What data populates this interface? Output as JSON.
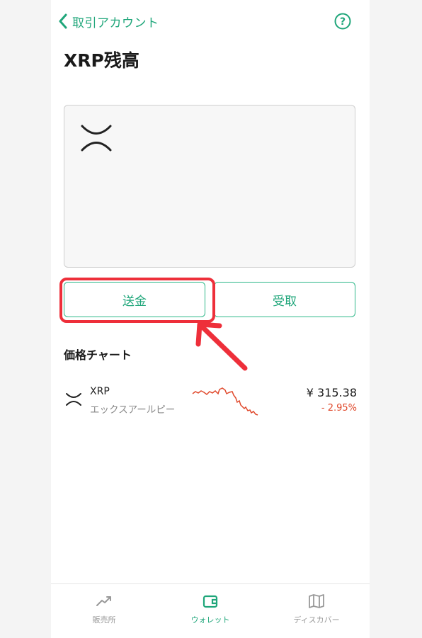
{
  "header": {
    "back_label": "取引アカウント"
  },
  "page": {
    "title": "XRP残高"
  },
  "actions": {
    "send_label": "送金",
    "receive_label": "受取"
  },
  "price_chart": {
    "section_title": "価格チャート",
    "coin_symbol": "XRP",
    "coin_name": "エックスアールピー",
    "price": "¥ 315.38",
    "change": "- 2.95%"
  },
  "tabbar": {
    "items": [
      {
        "label": "販売所",
        "icon": "trend-icon",
        "active": false
      },
      {
        "label": "ウォレット",
        "icon": "wallet-icon",
        "active": true
      },
      {
        "label": "ディスカバー",
        "icon": "map-icon",
        "active": false
      }
    ]
  },
  "colors": {
    "accent": "#1fa67a",
    "negative": "#e0492c",
    "highlight": "#ee2f3a"
  }
}
